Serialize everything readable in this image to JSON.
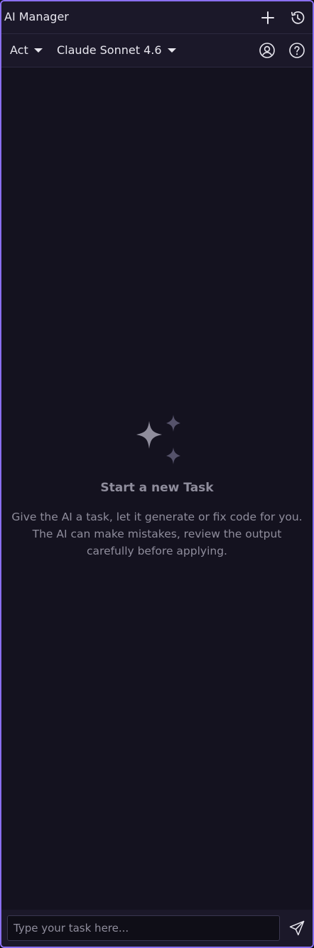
{
  "header": {
    "title": "AI Manager",
    "icons": [
      "plus-icon",
      "history-icon"
    ]
  },
  "toolbar": {
    "mode": "Act",
    "model": "Claude Sonnet 4.6",
    "icons": [
      "account-icon",
      "help-icon"
    ]
  },
  "empty_state": {
    "icon": "sparkles-icon",
    "title": "Start a new Task",
    "description": "Give the AI a task, let it generate or fix code for you. The AI can make mistakes, review the output carefully before applying."
  },
  "composer": {
    "placeholder": "Type your task here...",
    "value": "",
    "send_icon": "send-icon"
  },
  "colors": {
    "accent_border": "#8a6ff0",
    "background": "#14121f",
    "bar": "#1b1829",
    "text": "#e7e6ee",
    "muted_text": "#8f8d9c"
  }
}
